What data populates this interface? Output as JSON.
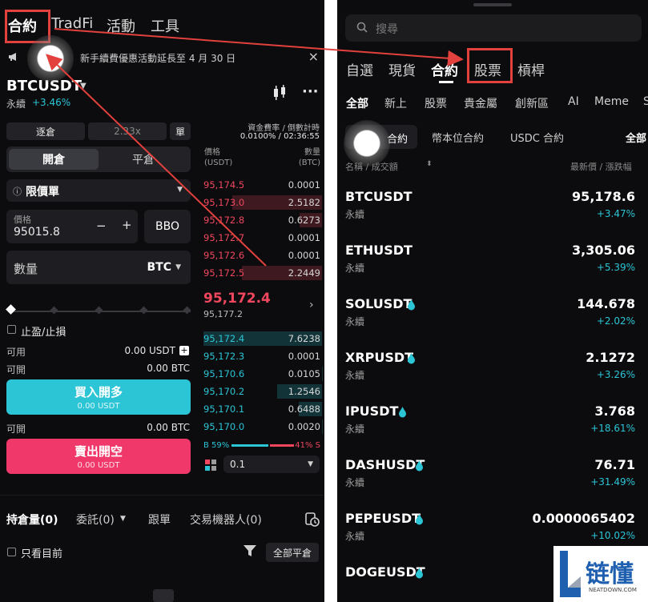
{
  "left": {
    "top_tabs": [
      "合約",
      "TradFi",
      "活動",
      "工具"
    ],
    "notice": "新手續費優惠活動延長至 4 月 30 日",
    "pair": "BTCUSDT",
    "pair_type": "永續",
    "pair_change": "+3.46%",
    "margin_mode": "逐倉",
    "leverage": "2.33x",
    "single": "單",
    "funding_label": "資金費率 / 倒數計時",
    "funding_value": "0.0100% / 02:36:55",
    "open_label": "開倉",
    "close_label": "平倉",
    "order_type": "限價單",
    "price_label": "價格",
    "price_value": "95015.8",
    "minus": "−",
    "plus": "+",
    "bbo": "BBO",
    "qty_label": "數量",
    "qty_unit": "BTC",
    "tpsl_label": "止盈/止損",
    "available_label": "可用",
    "available_value": "0.00 USDT",
    "can_open_label": "可開",
    "can_open_buy": "0.00 BTC",
    "buy_label": "買入開多",
    "buy_sub": "0.00 USDT",
    "can_open_sell": "0.00 BTC",
    "sell_label": "賣出開空",
    "sell_sub": "0.00 USDT",
    "ob_price_header": "價格\n(USDT)",
    "ob_qty_header": "數量\n(BTC)",
    "asks": [
      {
        "price": "95,174.5",
        "qty": "0.0001"
      },
      {
        "price": "95,173.0",
        "qty": "2.5182"
      },
      {
        "price": "95,172.8",
        "qty": "0.6273"
      },
      {
        "price": "95,172.7",
        "qty": "0.0001"
      },
      {
        "price": "95,172.6",
        "qty": "0.0001"
      },
      {
        "price": "95,172.5",
        "qty": "2.2449"
      }
    ],
    "last_price": "95,172.4",
    "mark_price": "95,177.2",
    "bids": [
      {
        "price": "95,172.4",
        "qty": "7.6238"
      },
      {
        "price": "95,172.3",
        "qty": "0.0001"
      },
      {
        "price": "95,170.6",
        "qty": "0.0105"
      },
      {
        "price": "95,170.2",
        "qty": "1.2546"
      },
      {
        "price": "95,170.1",
        "qty": "0.6488"
      },
      {
        "price": "95,170.0",
        "qty": "0.0020"
      }
    ],
    "buy_ratio": "B 59%",
    "sell_ratio": "41% S",
    "depth_step": "0.1",
    "bottom_tabs": [
      "持倉量(0)",
      "委託(0)",
      "跟單",
      "交易機器人(0)"
    ],
    "only_current": "只看目前",
    "close_all": "全部平倉"
  },
  "right": {
    "search_placeholder": "搜尋",
    "tabs1": [
      "自選",
      "現貨",
      "合約",
      "股票",
      "槓桿"
    ],
    "tabs2": [
      "全部",
      "新上",
      "股票",
      "貴金屬",
      "創新區",
      "AI",
      "Meme",
      "S"
    ],
    "chips": [
      "合約",
      "幣本位合約",
      "USDC 合約",
      "全部"
    ],
    "col_left": "名稱 / 成交額",
    "col_right": "最新價 / 漲跌幅",
    "coins": [
      {
        "symbol": "BTCUSDT",
        "sub": "永續",
        "price": "95,178.6",
        "change": "+3.47%",
        "drop": false
      },
      {
        "symbol": "ETHUSDT",
        "sub": "永續",
        "price": "3,305.06",
        "change": "+5.39%",
        "drop": false
      },
      {
        "symbol": "SOLUSDT",
        "sub": "永續",
        "price": "144.678",
        "change": "+2.02%",
        "drop": true
      },
      {
        "symbol": "XRPUSDT",
        "sub": "永續",
        "price": "2.1272",
        "change": "+3.26%",
        "drop": true
      },
      {
        "symbol": "IPUSDT",
        "sub": "永續",
        "price": "3.768",
        "change": "+18.61%",
        "drop": true
      },
      {
        "symbol": "DASHUSDT",
        "sub": "永續",
        "price": "76.71",
        "change": "+31.49%",
        "drop": true
      },
      {
        "symbol": "PEPEUSDT",
        "sub": "永續",
        "price": "0.0000065402",
        "change": "+10.02%",
        "drop": true
      },
      {
        "symbol": "DOGEUSDT",
        "sub": "",
        "price": "",
        "change": "",
        "drop": true
      }
    ]
  },
  "watermark": {
    "text": "链懂",
    "sub": "NEATDOWN.COM"
  },
  "colors": {
    "bg": "#0c0c0e",
    "accent_buy": "#2bc5d6",
    "accent_sell": "#f0475e",
    "highlight": "#e2413d"
  }
}
